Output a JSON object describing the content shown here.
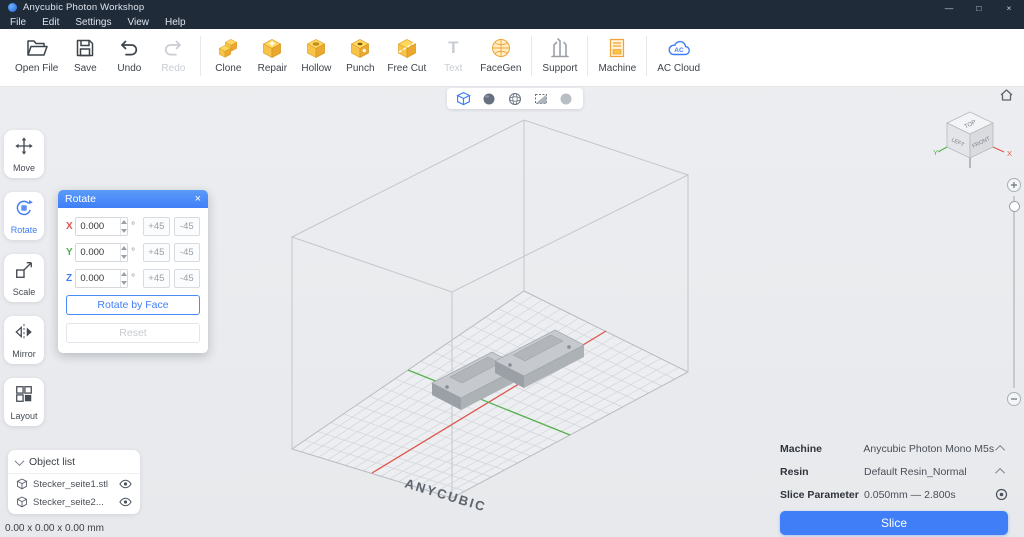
{
  "window": {
    "title": "Anycubic Photon Workshop",
    "minimize": "—",
    "maximize": "□",
    "close": "×"
  },
  "menu": {
    "items": [
      {
        "label": "File"
      },
      {
        "label": "Edit"
      },
      {
        "label": "Settings"
      },
      {
        "label": "View"
      },
      {
        "label": "Help"
      }
    ]
  },
  "toolbar": {
    "ac_badge": "AC",
    "items": [
      {
        "label": "Open File"
      },
      {
        "label": "Save"
      },
      {
        "label": "Undo"
      },
      {
        "label": "Redo"
      },
      {
        "label": "Clone"
      },
      {
        "label": "Repair"
      },
      {
        "label": "Hollow"
      },
      {
        "label": "Punch"
      },
      {
        "label": "Free Cut"
      },
      {
        "label": "Text"
      },
      {
        "label": "FaceGen"
      },
      {
        "label": "Support"
      },
      {
        "label": "Machine"
      },
      {
        "label": "AC Cloud"
      }
    ]
  },
  "tools": {
    "items": [
      {
        "label": "Move"
      },
      {
        "label": "Rotate"
      },
      {
        "label": "Scale"
      },
      {
        "label": "Mirror"
      },
      {
        "label": "Layout"
      }
    ]
  },
  "rotate_panel": {
    "title": "Rotate",
    "close": "×",
    "axes": [
      {
        "axis": "X",
        "value": "0.000",
        "unit": "°",
        "plus": "+45",
        "minus": "-45"
      },
      {
        "axis": "Y",
        "value": "0.000",
        "unit": "°",
        "plus": "+45",
        "minus": "-45"
      },
      {
        "axis": "Z",
        "value": "0.000",
        "unit": "°",
        "plus": "+45",
        "minus": "-45"
      }
    ],
    "rotate_by_face": "Rotate by Face",
    "reset": "Reset"
  },
  "view_cube": {
    "top": "TOP",
    "left": "LEFT",
    "front": "FRONT",
    "axis_x": "X",
    "axis_y": "Y"
  },
  "object_list": {
    "title": "Object list",
    "items": [
      {
        "name": "Stecker_seite1.stl"
      },
      {
        "name": "Stecker_seite2..."
      }
    ]
  },
  "settings": {
    "machine_label": "Machine",
    "machine_value": "Anycubic Photon Mono M5s",
    "resin_label": "Resin",
    "resin_value": "Default Resin_Normal",
    "slice_param_label": "Slice Parameter",
    "slice_param_value": "0.050mm — 2.800s",
    "slice_button": "Slice"
  },
  "scene": {
    "watermark": "ANYCUBIC"
  },
  "status": {
    "dimensions": "0.00 x 0.00 x 0.00 mm"
  },
  "colors": {
    "accent": "#3f7ef7",
    "titlebar": "#202b3a",
    "axis_x": "#e2574a",
    "axis_y": "#57b14e"
  }
}
